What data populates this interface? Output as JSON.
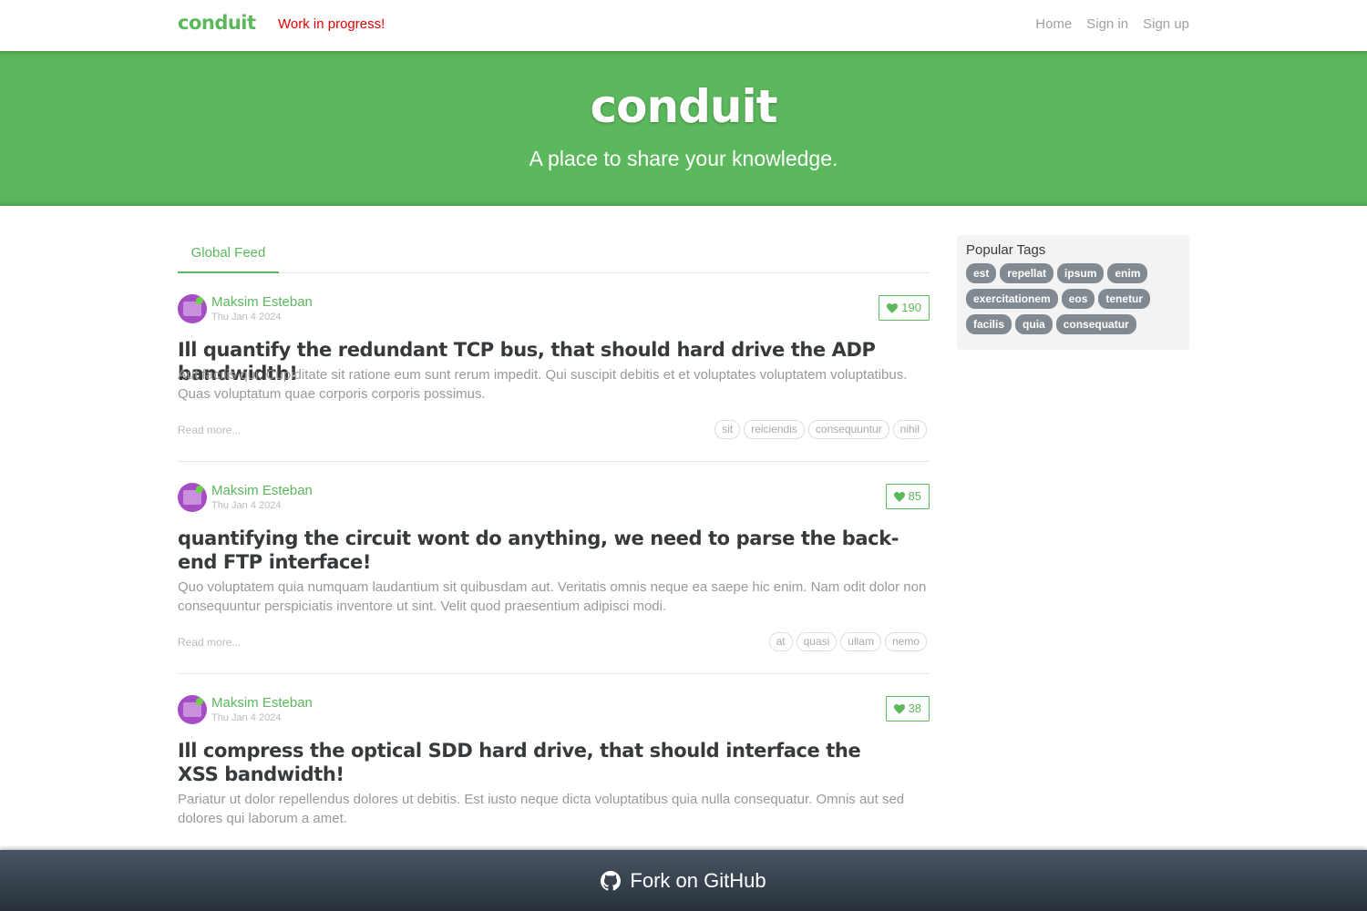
{
  "nav": {
    "brand": "conduit",
    "wip": "Work in progress!",
    "links": [
      "Home",
      "Sign in",
      "Sign up"
    ]
  },
  "banner": {
    "title": "conduit",
    "subtitle": "A place to share your knowledge."
  },
  "feed": {
    "tab": "Global Feed"
  },
  "articles": [
    {
      "author": "Maksim Esteban",
      "date": "Thu Jan 4 2024",
      "favorites": "190",
      "title": "Ill quantify the redundant TCP bus, that should hard drive the ADP bandwidth!",
      "description": "Aut facilis qui. Cupiditate sit ratione eum sunt rerum impedit. Qui suscipit debitis et et voluptates voluptatem voluptatibus. Quas voluptatum quae corporis corporis possimus.",
      "read_more": "Read more...",
      "tags": [
        "sit",
        "reiciendis",
        "consequuntur",
        "nihil"
      ]
    },
    {
      "author": "Maksim Esteban",
      "date": "Thu Jan 4 2024",
      "favorites": "85",
      "title": "quantifying the circuit wont do anything, we need to parse the back-end FTP interface!",
      "description": "Quo voluptatem quia numquam laudantium sit quibusdam aut. Veritatis omnis neque ea saepe hic enim. Nam odit dolor non consequuntur perspiciatis inventore ut sint. Velit quod praesentium adipisci modi.",
      "read_more": "Read more...",
      "tags": [
        "at",
        "quasi",
        "ullam",
        "nemo"
      ]
    },
    {
      "author": "Maksim Esteban",
      "date": "Thu Jan 4 2024",
      "favorites": "38",
      "title": "Ill compress the optical SDD hard drive, that should interface the XSS bandwidth!",
      "description": "Pariatur ut dolor repellendus dolores ut debitis. Est iusto neque dicta voluptatibus quia nulla consequatur. Omnis aut sed dolores qui laborum a amet."
    }
  ],
  "sidebar": {
    "heading": "Popular Tags",
    "tags": [
      "est",
      "repellat",
      "ipsum",
      "enim",
      "exercitationem",
      "eos",
      "tenetur",
      "facilis",
      "quia",
      "consequatur"
    ]
  },
  "footer": {
    "label": "Fork on GitHub"
  },
  "colors": {
    "brand": "#5cb85c",
    "wip": "#e60000",
    "tag_pill": "#818a91",
    "footer_top": "#485563",
    "footer_bottom": "#29323c"
  }
}
